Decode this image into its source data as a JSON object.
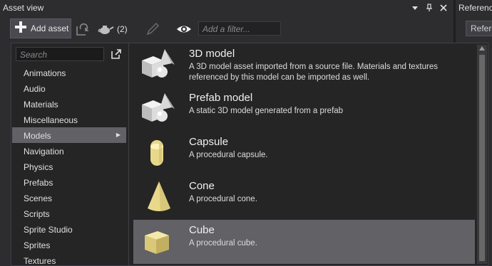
{
  "panel": {
    "title": "Asset view"
  },
  "right_panel": {
    "title": "References",
    "button_label": "References"
  },
  "toolbar": {
    "add_label": "Add asset",
    "count_label": "(2)",
    "filter_placeholder": "Add a filter..."
  },
  "popup": {
    "search_placeholder": "Search",
    "categories": [
      {
        "label": "Animations"
      },
      {
        "label": "Audio"
      },
      {
        "label": "Materials"
      },
      {
        "label": "Miscellaneous"
      },
      {
        "label": "Models",
        "selected": true
      },
      {
        "label": "Navigation"
      },
      {
        "label": "Physics"
      },
      {
        "label": "Prefabs"
      },
      {
        "label": "Scenes"
      },
      {
        "label": "Scripts"
      },
      {
        "label": "Sprite Studio"
      },
      {
        "label": "Sprites"
      },
      {
        "label": "Textures"
      }
    ],
    "assets": [
      {
        "name": "3D model",
        "description": "A 3D model asset imported from a source file. Materials and textures referenced by this model can be imported as well.",
        "icon": "model-icon"
      },
      {
        "name": "Prefab model",
        "description": "A static 3D model generated from a prefab",
        "icon": "prefab-model-icon"
      },
      {
        "name": "Capsule",
        "description": "A procedural capsule.",
        "icon": "capsule-icon"
      },
      {
        "name": "Cone",
        "description": "A procedural cone.",
        "icon": "cone-icon"
      },
      {
        "name": "Cube",
        "description": "A procedural cube.",
        "icon": "cube-icon",
        "selected": true
      }
    ]
  },
  "colors": {
    "background": "#2d2d30",
    "selection": "#616166",
    "primitive": "#e8d88a"
  }
}
